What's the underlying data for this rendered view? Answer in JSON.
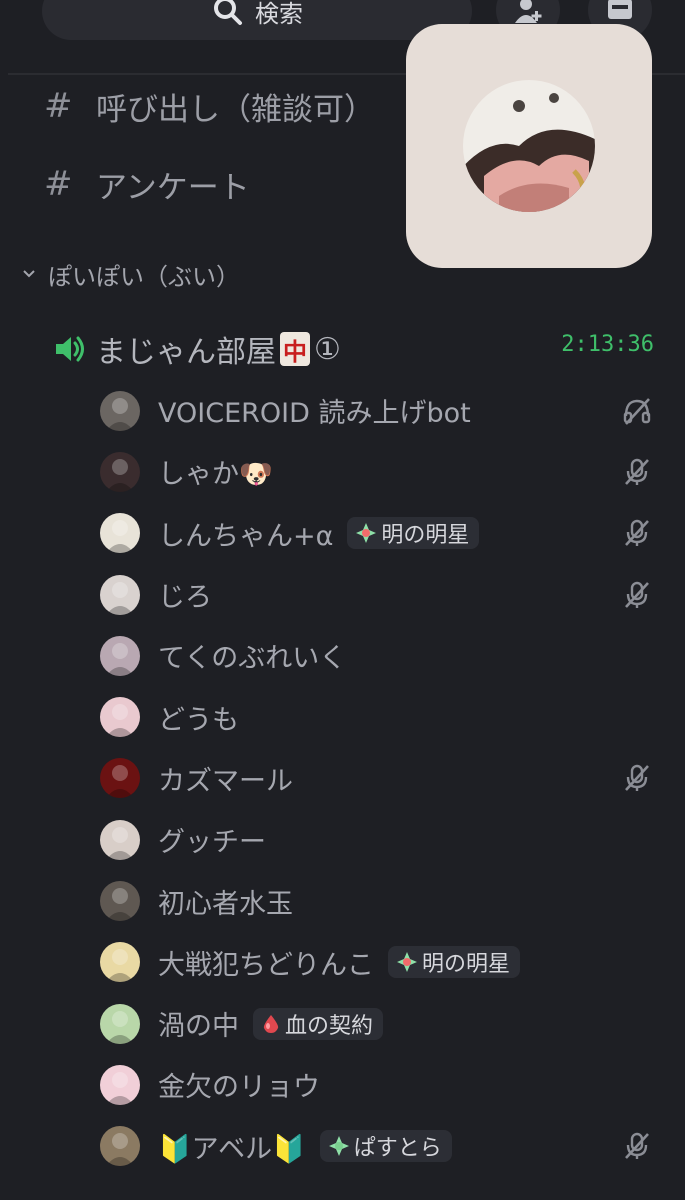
{
  "topbar": {
    "search_label": "検索",
    "icons": [
      "search-icon",
      "add-member-icon",
      "inbox-icon"
    ]
  },
  "text_channels": [
    {
      "name": "呼び出し（雑談可）"
    },
    {
      "name": "アンケート"
    }
  ],
  "category": {
    "name": "ぽいぽい（ぶい）",
    "collapsed": false
  },
  "voice_channel": {
    "name": "まじゃん部屋",
    "emoji": "中",
    "suffix": "①",
    "elapsed": "2:13:36"
  },
  "members": [
    {
      "name": "VOICEROID 読み上げbot",
      "tag": "",
      "status": "deafened",
      "avatar_color": "#6b6662"
    },
    {
      "name": "しゃか🐶",
      "tag": "",
      "status": "muted",
      "avatar_color": "#3a2c2e"
    },
    {
      "name": "しんちゃん+α",
      "tag": "明の明星",
      "tag_icon": "star-gem",
      "status": "muted",
      "avatar_color": "#e8e3d8"
    },
    {
      "name": "じろ",
      "tag": "",
      "status": "muted",
      "avatar_color": "#d9d2cf"
    },
    {
      "name": "てくのぶれいく",
      "tag": "",
      "status": "",
      "avatar_color": "#b9a8b2"
    },
    {
      "name": "どうも",
      "tag": "",
      "status": "",
      "avatar_color": "#e9c9cf"
    },
    {
      "name": "カズマール",
      "tag": "",
      "status": "muted",
      "avatar_color": "#6b1212"
    },
    {
      "name": "グッチー",
      "tag": "",
      "status": "",
      "avatar_color": "#d8cec8"
    },
    {
      "name": "初心者水玉",
      "tag": "",
      "status": "",
      "avatar_color": "#5f5852"
    },
    {
      "name": "大戦犯ちどりんこ",
      "tag": "明の明星",
      "tag_icon": "star-gem",
      "status": "",
      "avatar_color": "#e9d9a4"
    },
    {
      "name": "渦の中",
      "tag": "血の契約",
      "tag_icon": "blood-drop",
      "status": "",
      "avatar_color": "#b9d7a9"
    },
    {
      "name": "金欠のリョウ",
      "tag": "",
      "status": "",
      "avatar_color": "#f1cfd8"
    },
    {
      "name": "🔰アベル🔰",
      "tag": "ぱすとら",
      "tag_icon": "star-gem-green",
      "status": "muted",
      "avatar_color": "#8b7a62"
    }
  ],
  "colors": {
    "background": "#1e1f24",
    "speaking_green": "#3fbf6a",
    "pip_background": "#e6ddd7"
  }
}
